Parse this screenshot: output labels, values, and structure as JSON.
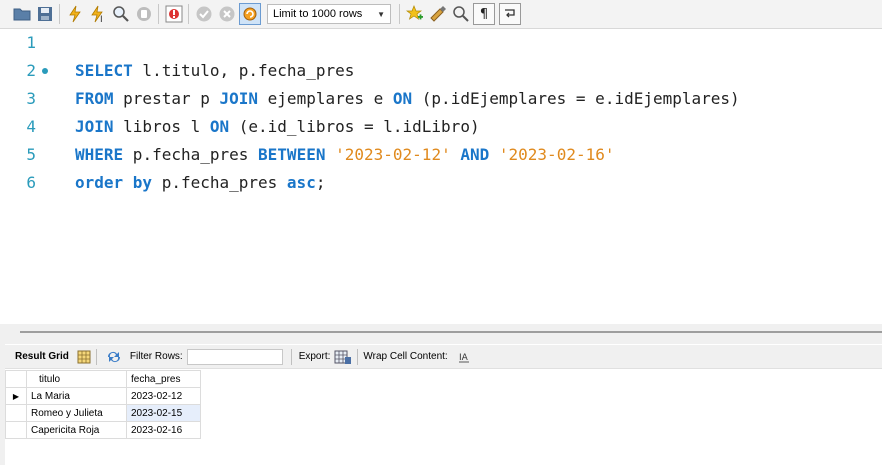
{
  "toolbar": {
    "limit_label": "Limit to 1000 rows",
    "icons": [
      "folder-icon",
      "save-icon",
      "lightning-icon",
      "lightning-cursor-icon",
      "magnifier-icon",
      "stop-icon",
      "error-toggle-icon",
      "commit-icon",
      "rollback-icon",
      "autocommit-icon",
      "star-add-icon",
      "broom-icon",
      "search-icon",
      "paragraph-icon",
      "wrap-icon"
    ]
  },
  "editor": {
    "lines": [
      {
        "num": "1",
        "tokens": []
      },
      {
        "num": "2",
        "tokens": [
          {
            "t": "kw",
            "v": "SELECT"
          },
          {
            "t": "id",
            "v": " l.titulo, p.fecha_pres"
          }
        ]
      },
      {
        "num": "3",
        "tokens": [
          {
            "t": "kw",
            "v": "FROM"
          },
          {
            "t": "id",
            "v": " prestar p "
          },
          {
            "t": "kw",
            "v": "JOIN"
          },
          {
            "t": "id",
            "v": " ejemplares e "
          },
          {
            "t": "kw",
            "v": "ON"
          },
          {
            "t": "id",
            "v": " (p.idEjemplares = e.idEjemplares)"
          }
        ]
      },
      {
        "num": "4",
        "tokens": [
          {
            "t": "kw",
            "v": "JOIN"
          },
          {
            "t": "id",
            "v": " libros l "
          },
          {
            "t": "kw",
            "v": "ON"
          },
          {
            "t": "id",
            "v": " (e.id_libros = l.idLibro)"
          }
        ]
      },
      {
        "num": "5",
        "tokens": [
          {
            "t": "kw",
            "v": "WHERE"
          },
          {
            "t": "id",
            "v": " p.fecha_pres "
          },
          {
            "t": "kw",
            "v": "BETWEEN"
          },
          {
            "t": "id",
            "v": " "
          },
          {
            "t": "str",
            "v": "'2023-02-12'"
          },
          {
            "t": "id",
            "v": " "
          },
          {
            "t": "kw",
            "v": "AND"
          },
          {
            "t": "id",
            "v": " "
          },
          {
            "t": "str",
            "v": "'2023-02-16'"
          }
        ]
      },
      {
        "num": "6",
        "tokens": [
          {
            "t": "kw",
            "v": "order by"
          },
          {
            "t": "id",
            "v": " p.fecha_pres "
          },
          {
            "t": "kw",
            "v": "asc"
          },
          {
            "t": "id",
            "v": ";"
          }
        ]
      }
    ]
  },
  "result_bar": {
    "result_grid": "Result Grid",
    "filter_rows": "Filter Rows:",
    "export": "Export:",
    "wrap_cell": "Wrap Cell Content:"
  },
  "grid": {
    "columns": [
      "titulo",
      "fecha_pres"
    ],
    "rows": [
      [
        "La Maria",
        "2023-02-12"
      ],
      [
        "Romeo y Julieta",
        "2023-02-15"
      ],
      [
        "Capericita Roja",
        "2023-02-16"
      ]
    ]
  },
  "colors": {
    "keyword": "#1a76c9",
    "string": "#e08a1e",
    "line_number": "#2a9bbb"
  }
}
